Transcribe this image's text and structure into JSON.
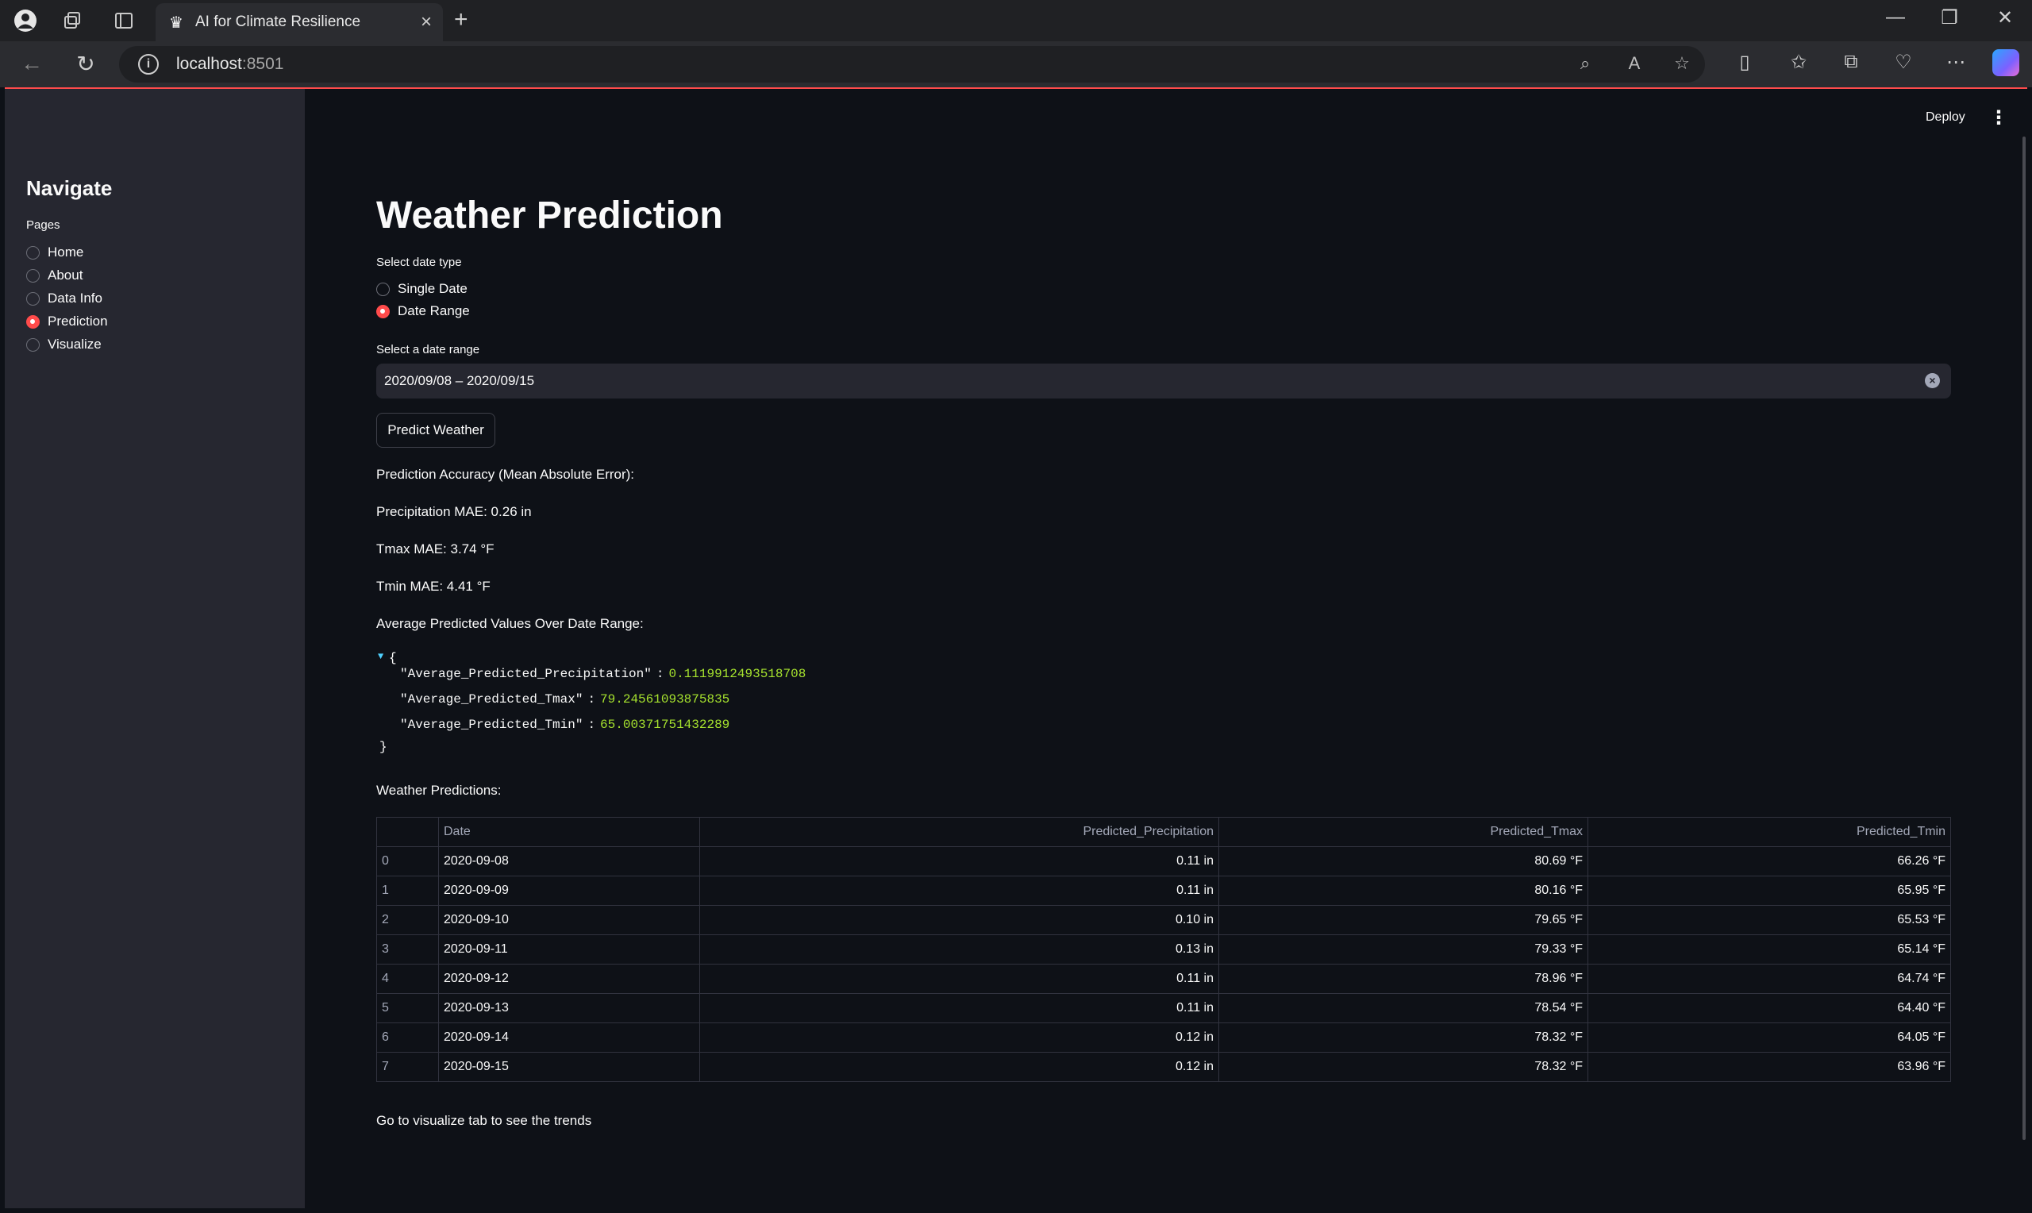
{
  "browser": {
    "tab_title": "AI for Climate Resilience",
    "url_host": "localhost",
    "url_port": ":8501"
  },
  "sidebar": {
    "heading": "Navigate",
    "pages_label": "Pages",
    "items": [
      {
        "label": "Home",
        "selected": false
      },
      {
        "label": "About",
        "selected": false
      },
      {
        "label": "Data Info",
        "selected": false
      },
      {
        "label": "Prediction",
        "selected": true
      },
      {
        "label": "Visualize",
        "selected": false
      }
    ]
  },
  "header": {
    "deploy_label": "Deploy"
  },
  "main": {
    "title": "Weather Prediction",
    "date_type_label": "Select date type",
    "date_type_options": [
      {
        "label": "Single Date",
        "selected": false
      },
      {
        "label": "Date Range",
        "selected": true
      }
    ],
    "date_range_label": "Select a date range",
    "date_range_value": "2020/09/08 – 2020/09/15",
    "predict_button": "Predict Weather",
    "accuracy_heading": "Prediction Accuracy (Mean Absolute Error):",
    "precip_mae": "Precipitation MAE: 0.26 in",
    "tmax_mae": "Tmax MAE: 3.74 °F",
    "tmin_mae": "Tmin MAE: 4.41 °F",
    "avg_heading": "Average Predicted Values Over Date Range:",
    "json_entries": [
      {
        "key": "\"Average_Predicted_Precipitation\"",
        "value": "0.1119912493518708"
      },
      {
        "key": "\"Average_Predicted_Tmax\"",
        "value": "79.24561093875835"
      },
      {
        "key": "\"Average_Predicted_Tmin\"",
        "value": "65.00371751432289"
      }
    ],
    "predictions_heading": "Weather Predictions:",
    "table": {
      "columns": [
        "",
        "Date",
        "Predicted_Precipitation",
        "Predicted_Tmax",
        "Predicted_Tmin"
      ],
      "rows": [
        [
          "0",
          "2020-09-08",
          "0.11 in",
          "80.69 °F",
          "66.26 °F"
        ],
        [
          "1",
          "2020-09-09",
          "0.11 in",
          "80.16 °F",
          "65.95 °F"
        ],
        [
          "2",
          "2020-09-10",
          "0.10 in",
          "79.65 °F",
          "65.53 °F"
        ],
        [
          "3",
          "2020-09-11",
          "0.13 in",
          "79.33 °F",
          "65.14 °F"
        ],
        [
          "4",
          "2020-09-12",
          "0.11 in",
          "78.96 °F",
          "64.74 °F"
        ],
        [
          "5",
          "2020-09-13",
          "0.11 in",
          "78.54 °F",
          "64.40 °F"
        ],
        [
          "6",
          "2020-09-14",
          "0.12 in",
          "78.32 °F",
          "64.05 °F"
        ],
        [
          "7",
          "2020-09-15",
          "0.12 in",
          "78.32 °F",
          "63.96 °F"
        ]
      ]
    },
    "footer_text": "Go to visualize tab to see the trends"
  },
  "colors": {
    "accent": "#ff4b4b",
    "background": "#0e1117",
    "sidebar": "#262730",
    "json_value": "#a6e22e"
  }
}
